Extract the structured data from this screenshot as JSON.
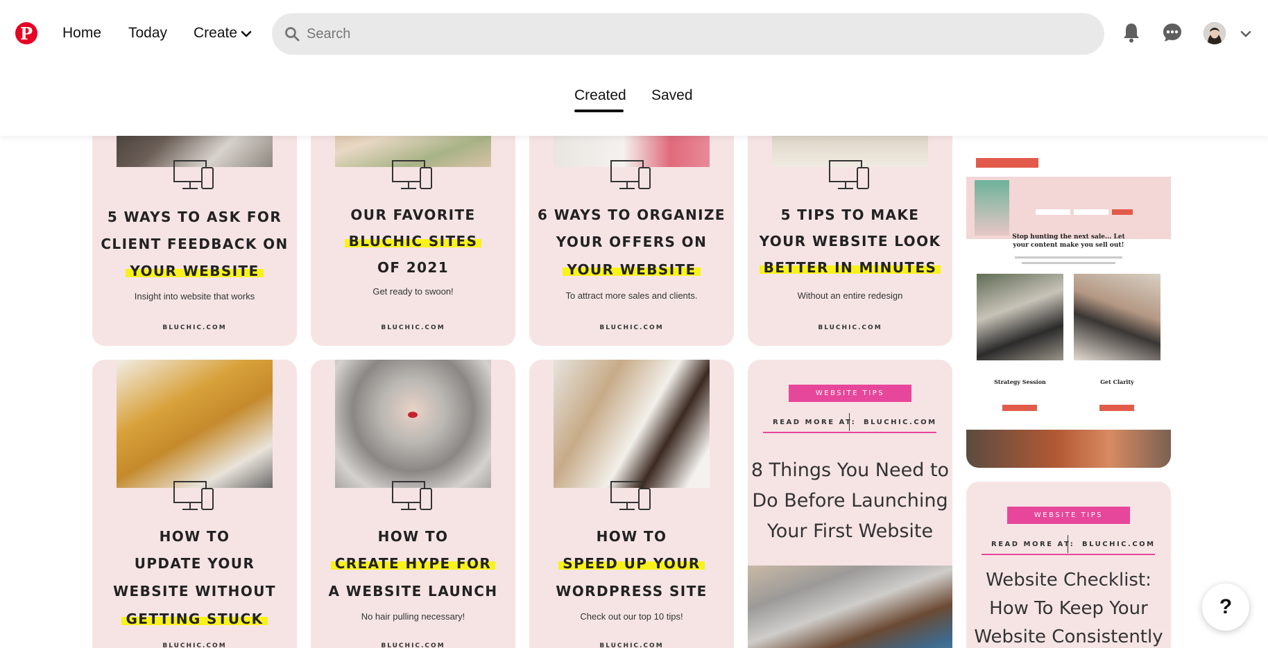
{
  "header": {
    "logo_letter": "P",
    "nav": {
      "home": "Home",
      "today": "Today",
      "create": "Create"
    },
    "search": {
      "placeholder": "Search"
    },
    "icons": [
      "pinterest-logo",
      "chevron-down-icon",
      "search-icon",
      "bell-icon",
      "chat-icon",
      "avatar",
      "chevron-down-icon"
    ],
    "brand_color": "#e60023"
  },
  "tabs": {
    "created": "Created",
    "saved": "Saved",
    "active": "Created"
  },
  "pins": {
    "p1": {
      "line1": "5 WAYS TO ASK FOR",
      "line2": "CLIENT FEEDBACK ON",
      "line3": "YOUR WEBSITE",
      "sub": "Insight into website that works",
      "foot": "BLUCHIC.COM"
    },
    "p2": {
      "line1": "OUR FAVORITE",
      "line2": "BLUCHIC SITES",
      "line3": "OF 2021",
      "sub": "Get ready to swoon!",
      "foot": "BLUCHIC.COM"
    },
    "p3": {
      "line1": "6 WAYS TO ORGANIZE",
      "line2": "YOUR OFFERS ON",
      "line3": "YOUR WEBSITE",
      "sub": "To attract more sales and clients.",
      "foot": "BLUCHIC.COM"
    },
    "p4": {
      "line1": "5 TIPS TO MAKE",
      "line2": "YOUR WEBSITE LOOK",
      "line3": "BETTER IN MINUTES",
      "sub": "Without an entire redesign",
      "foot": "BLUCHIC.COM"
    },
    "p5": {
      "heading": "Stop hunting the next sale... Let your content make you sell out!",
      "card1": "Strategy Session",
      "card2": "Get Clarity"
    },
    "p6": {
      "line1": "HOW TO",
      "line2": "UPDATE YOUR",
      "line3": "WEBSITE WITHOUT",
      "line4": "GETTING STUCK",
      "foot": "BLUCHIC.COM"
    },
    "p7": {
      "line1": "HOW TO",
      "line2": "CREATE HYPE FOR",
      "line3": "A WEBSITE LAUNCH",
      "sub": "No hair pulling necessary!",
      "foot": "BLUCHIC.COM"
    },
    "p8": {
      "line1": "HOW TO",
      "line2": "SPEED UP YOUR",
      "line3": "WORDPRESS SITE",
      "sub": "Check out our top 10 tips!",
      "foot": "BLUCHIC.COM"
    },
    "p9": {
      "badge": "WEBSITE TIPS",
      "read_more": "READ MORE AT:",
      "site": "BLUCHIC.COM",
      "line1": "8 Things You Need to",
      "line2": "Do Before Launching",
      "line3": "Your First Website"
    },
    "p10": {
      "badge": "WEBSITE TIPS",
      "read_more": "READ MORE AT:",
      "site": "BLUCHIC.COM",
      "line1": "Website Checklist:",
      "line2": "How To Keep Your",
      "line3": "Website Consistently"
    }
  },
  "colors": {
    "pin_bg": "#f6e4e4",
    "highlight": "#f8f21a",
    "accent_pink": "#e7479b"
  },
  "help": {
    "label": "?"
  }
}
